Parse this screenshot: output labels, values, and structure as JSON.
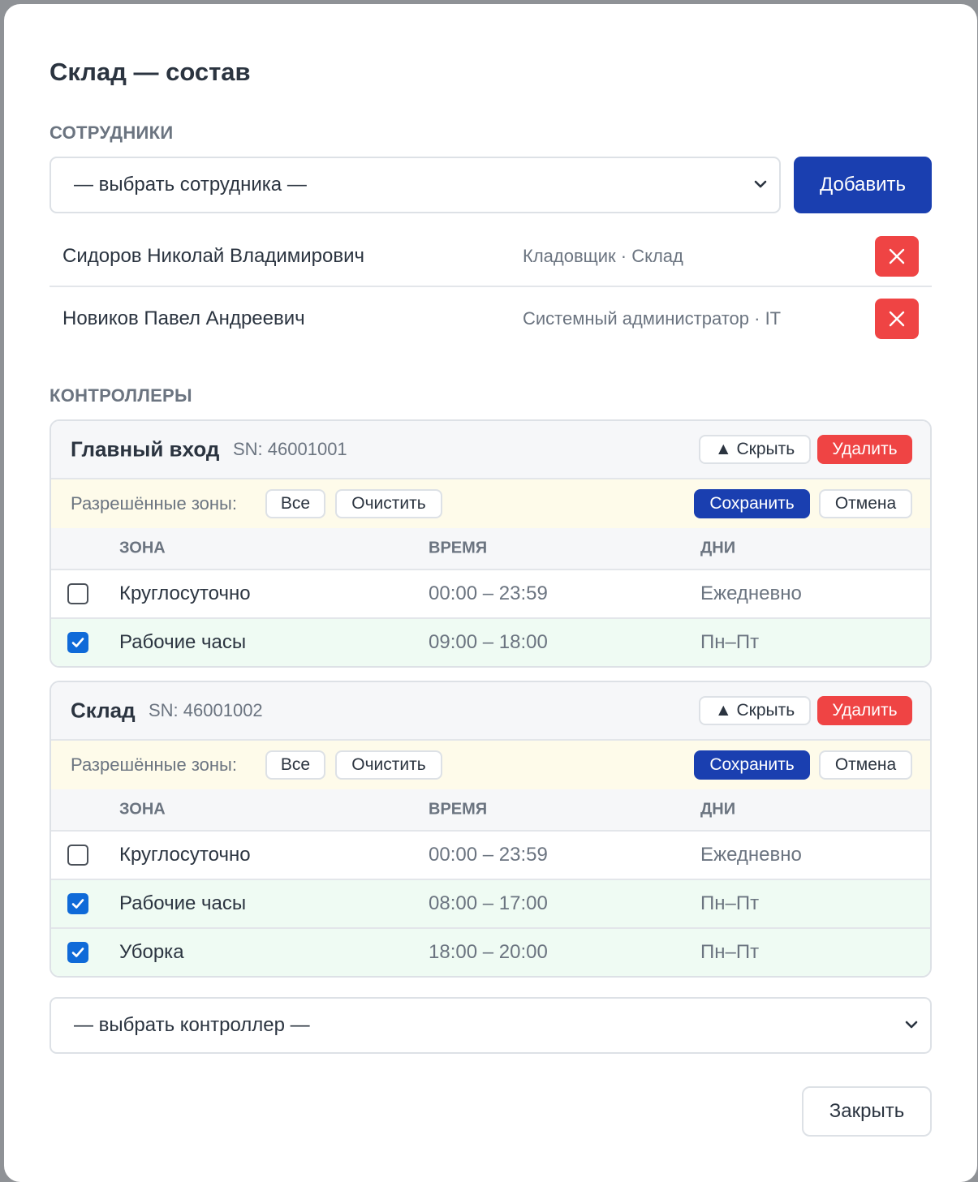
{
  "modal": {
    "title": "Склад — состав",
    "close_label": "Закрыть"
  },
  "employees": {
    "section_label": "СОТРУДНИКИ",
    "select_placeholder": "— выбрать сотрудника —",
    "add_label": "Добавить",
    "items": [
      {
        "name": "Сидоров Николай Владимирович",
        "role": "Кладовщик · Склад"
      },
      {
        "name": "Новиков Павел Андреевич",
        "role": "Системный администратор · IT"
      }
    ]
  },
  "controllers": {
    "section_label": "КОНТРОЛЛЕРЫ",
    "select_placeholder": "— выбрать контроллер —",
    "hide_label": "▲ Скрыть",
    "delete_label": "Удалить",
    "zones_label": "Разрешённые зоны:",
    "all_label": "Все",
    "clear_label": "Очистить",
    "save_label": "Сохранить",
    "cancel_label": "Отмена",
    "col_zone": "ЗОНА",
    "col_time": "ВРЕМЯ",
    "col_days": "ДНИ",
    "items": [
      {
        "name": "Главный вход",
        "sn": "SN: 46001001",
        "zones": [
          {
            "zone": "Круглосуточно",
            "time": "00:00 – 23:59",
            "days": "Ежедневно",
            "checked": false
          },
          {
            "zone": "Рабочие часы",
            "time": "09:00 – 18:00",
            "days": "Пн–Пт",
            "checked": true
          }
        ]
      },
      {
        "name": "Склад",
        "sn": "SN: 46001002",
        "zones": [
          {
            "zone": "Круглосуточно",
            "time": "00:00 – 23:59",
            "days": "Ежедневно",
            "checked": false
          },
          {
            "zone": "Рабочие часы",
            "time": "08:00 – 17:00",
            "days": "Пн–Пт",
            "checked": true
          },
          {
            "zone": "Уборка",
            "time": "18:00 – 20:00",
            "days": "Пн–Пт",
            "checked": true
          }
        ]
      }
    ]
  },
  "colors": {
    "primary": "#1a3fb0",
    "danger": "#ef4444",
    "checked_row": "#effbf3",
    "zones_bar": "#fefbea"
  }
}
